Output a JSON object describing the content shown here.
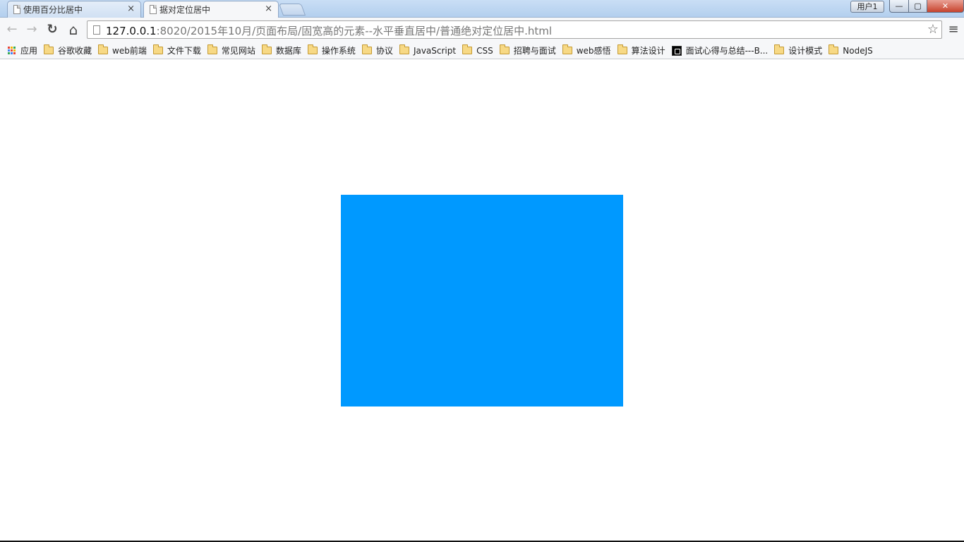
{
  "browser": {
    "tabs": [
      {
        "title": "使用百分比居中",
        "active": false
      },
      {
        "title": "据对定位居中",
        "active": true
      }
    ],
    "user_badge": "用户1",
    "window_buttons": {
      "minimize": "—",
      "maximize": "▢",
      "close": "✕"
    },
    "tab_close_glyph": "×"
  },
  "toolbar": {
    "back_icon": "←",
    "forward_icon": "→",
    "reload_icon": "↻",
    "home_icon": "⌂",
    "url_host": "127.0.0.1",
    "url_rest": ":8020/2015年10月/页面布局/固宽高的元素--水平垂直居中/普通绝对定位居中.html",
    "star_icon": "☆",
    "menu_icon": "≡"
  },
  "bookmarks": [
    {
      "label": "应用",
      "icon": "apps-icon"
    },
    {
      "label": "谷歌收藏",
      "icon": "folder-icon"
    },
    {
      "label": "web前端",
      "icon": "folder-icon"
    },
    {
      "label": "文件下载",
      "icon": "folder-icon"
    },
    {
      "label": "常见网站",
      "icon": "folder-icon"
    },
    {
      "label": "数据库",
      "icon": "folder-icon"
    },
    {
      "label": "操作系统",
      "icon": "folder-icon"
    },
    {
      "label": "协议",
      "icon": "folder-icon"
    },
    {
      "label": "JavaScript",
      "icon": "folder-icon"
    },
    {
      "label": "CSS",
      "icon": "folder-icon"
    },
    {
      "label": "招聘与面试",
      "icon": "folder-icon"
    },
    {
      "label": "web感悟",
      "icon": "folder-icon"
    },
    {
      "label": "算法设计",
      "icon": "folder-icon"
    },
    {
      "label": "面试心得与总结---B...",
      "icon": "site-icon"
    },
    {
      "label": "设计模式",
      "icon": "folder-icon"
    },
    {
      "label": "NodeJS",
      "icon": "folder-icon"
    }
  ],
  "page": {
    "box_color": "#0099ff",
    "background": "#ffffff"
  }
}
